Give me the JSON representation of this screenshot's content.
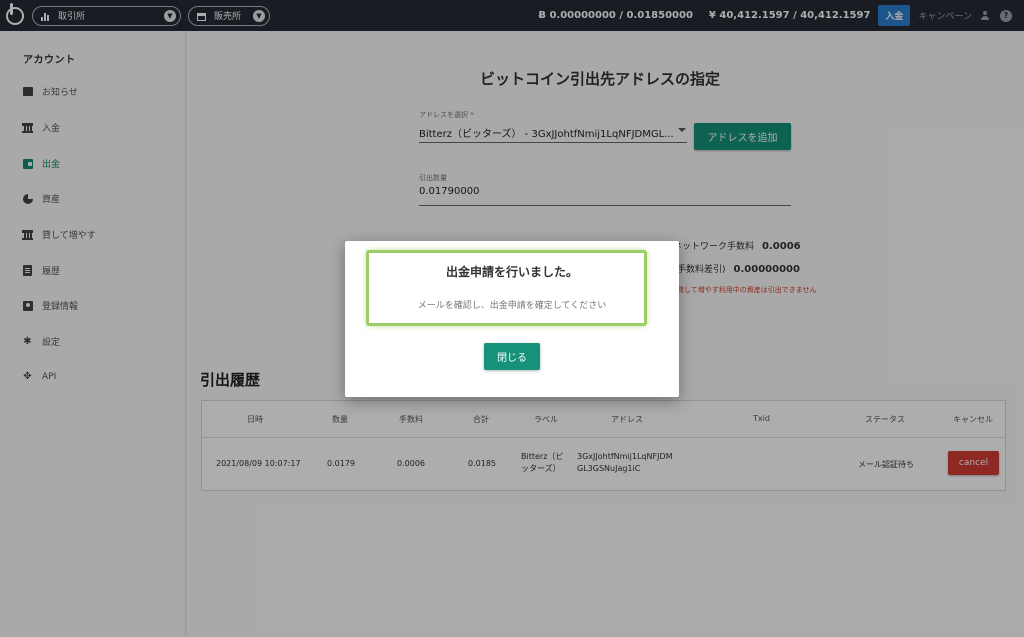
{
  "topbar": {
    "exchange_label": "取引所",
    "store_label": "販売所",
    "btc_balance": "Ƀ 0.00000000 / 0.01850000",
    "jpy_balance": "¥ 40,412.1597 / 40,412.1597",
    "deposit_label": "入金",
    "campaign_label": "キャンペーン",
    "help_glyph": "?"
  },
  "sidebar": {
    "title": "アカウント",
    "items": [
      {
        "label": "お知らせ",
        "icon": "message-icon"
      },
      {
        "label": "入金",
        "icon": "bank-icon"
      },
      {
        "label": "出金",
        "icon": "wallet-icon",
        "active": true
      },
      {
        "label": "資産",
        "icon": "pie-chart-icon"
      },
      {
        "label": "貸して増やす",
        "icon": "bank-icon"
      },
      {
        "label": "履歴",
        "icon": "document-icon"
      },
      {
        "label": "登録情報",
        "icon": "id-card-icon"
      },
      {
        "label": "設定",
        "icon": "gear-icon"
      },
      {
        "label": "API",
        "icon": "api-icon"
      }
    ]
  },
  "form": {
    "page_title": "ビットコイン引出先アドレスの指定",
    "address_label": "アドレスを選択 *",
    "address_value": "Bitterz（ビッターズ） - 3GxJJohtfNmij1LqNFJDMGL...",
    "add_address_label": "アドレスを追加",
    "amount_label": "引出数量",
    "amount_value": "0.01790000",
    "fee_label": "ネットワーク手数料",
    "fee_value": "0.0006",
    "net_label": "手数料差引)",
    "net_value": "0.00000000",
    "warning": "貸して増やす利用中の資産は引出できません"
  },
  "history": {
    "title": "引出履歴",
    "columns": [
      "日時",
      "数量",
      "手数料",
      "合計",
      "ラベル",
      "アドレス",
      "Txid",
      "ステータス",
      "キャンセル"
    ],
    "row": {
      "datetime": "2021/08/09 10:07:17",
      "amount": "0.0179",
      "fee": "0.0006",
      "total": "0.0185",
      "label_line1": "Bitterz（ビ",
      "label_line2": "ッターズ）",
      "address_line1": "3GxJJohtfNmij1LqNFJDM",
      "address_line2": "GL3GSNuJag1iC",
      "status": "メール認証待ち",
      "cancel_label": "cancel"
    }
  },
  "modal": {
    "title": "出金申請を行いました。",
    "message": "メールを確認し、出金申請を確定してください",
    "close_label": "閉じる"
  },
  "colors": {
    "topbar": "#262a33",
    "primary": "#16917a",
    "danger": "#d23b33",
    "highlight": "#9ccc65",
    "link_blue": "#2b7fd0"
  }
}
